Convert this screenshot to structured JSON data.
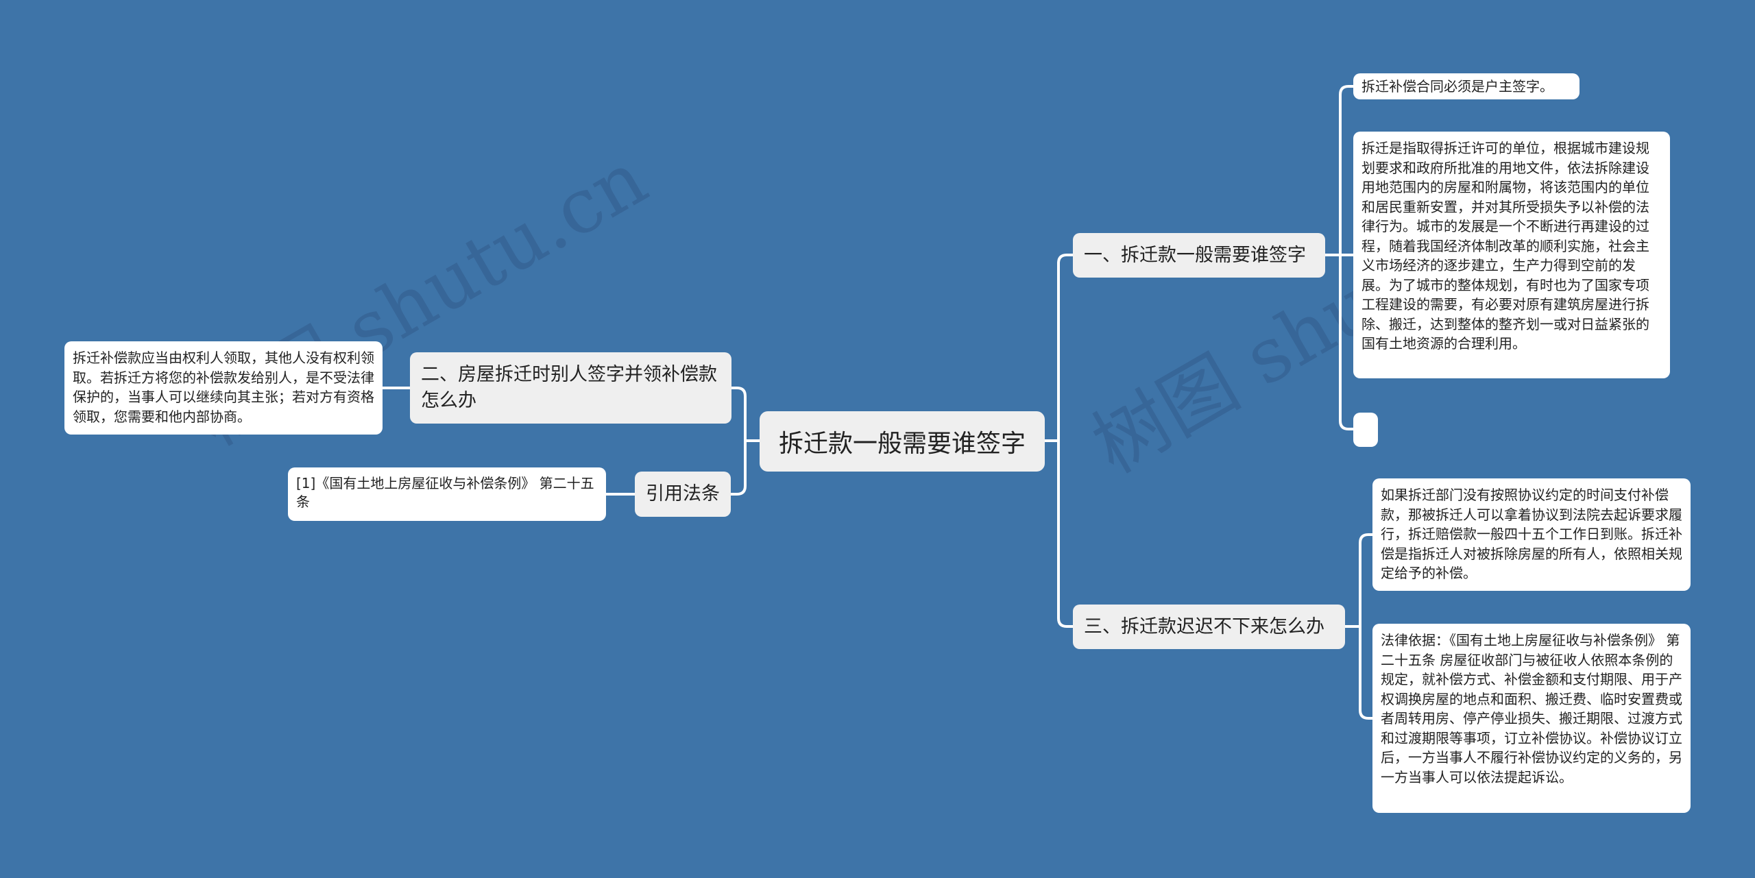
{
  "colors": {
    "background": "#3e74a8",
    "topic_fill": "#efefef",
    "leaf_fill": "#ffffff",
    "connector": "#ffffff"
  },
  "root": {
    "label": "拆迁款一般需要谁签字"
  },
  "branches": {
    "b1": {
      "label": "一、拆迁款一般需要谁签字",
      "children": [
        "拆迁补偿合同必须是户主签字。",
        "拆迁是指取得拆迁许可的单位，根据城市建设规划要求和政府所批准的用地文件，依法拆除建设用地范围内的房屋和附属物，将该范围内的单位和居民重新安置，并对其所受损失予以补偿的法律行为。城市的发展是一个不断进行再建设的过程，随着我国经济体制改革的顺利实施，社会主义市场经济的逐步建立，生产力得到空前的发展。为了城市的整体规划，有时也为了国家专项工程建设的需要，有必要对原有建筑房屋进行拆除、搬迁，达到整体的整齐划一或对日益紧张的国有土地资源的合理利用。",
        ""
      ]
    },
    "b2": {
      "label": "二、房屋拆迁时别人签字并领补偿款怎么办",
      "children": [
        "拆迁补偿款应当由权利人领取，其他人没有权利领取。若拆迁方将您的补偿款发给别人，是不受法律保护的，当事人可以继续向其主张；若对方有资格领取，您需要和他内部协商。"
      ]
    },
    "b3": {
      "label": "三、拆迁款迟迟不下来怎么办",
      "children": [
        "如果拆迁部门没有按照协议约定的时间支付补偿款，那被拆迁人可以拿着协议到法院去起诉要求履行，拆迁赔偿款一般四十五个工作日到账。拆迁补偿是指拆迁人对被拆除房屋的所有人，依照相关规定给予的补偿。",
        "法律依据：《国有土地上房屋征收与补偿条例》 第二十五条 房屋征收部门与被征收人依照本条例的规定，就补偿方式、补偿金额和支付期限、用于产权调换房屋的地点和面积、搬迁费、临时安置费或者周转用房、停产停业损失、搬迁期限、过渡方式和过渡期限等事项，订立补偿协议。补偿协议订立后，一方当事人不履行补偿协议约定的义务的，另一方当事人可以依法提起诉讼。"
      ]
    },
    "b4": {
      "label": "引用法条",
      "children": [
        "[1]《国有土地上房屋征收与补偿条例》 第二十五条"
      ]
    }
  },
  "watermark": {
    "text1": "树图 shutu.cn",
    "text2": "树图 shutu.cn"
  }
}
